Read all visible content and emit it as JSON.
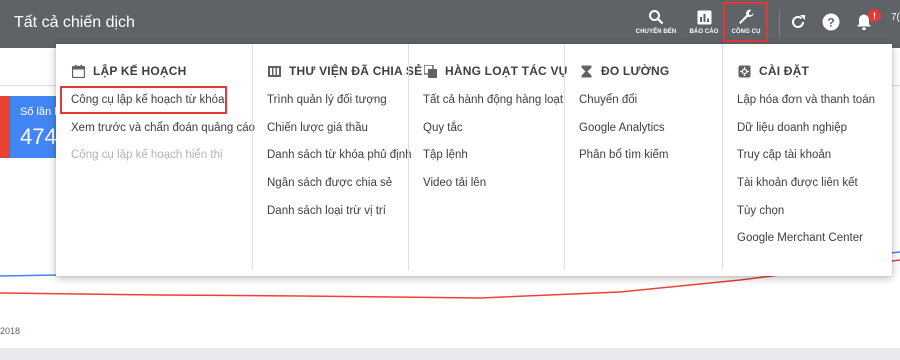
{
  "header": {
    "page_title": "Tất cả chiến dịch",
    "buttons": [
      {
        "label": "CHUYỂN ĐẾN",
        "icon": "search-icon"
      },
      {
        "label": "BÁO CÁO",
        "icon": "bar-chart-icon"
      },
      {
        "label": "CÔNG CỤ",
        "icon": "wrench-icon"
      }
    ],
    "refresh_icon": "refresh-icon",
    "help_icon": "help-icon",
    "notifications_icon": "bell-icon",
    "notification_badge": "!",
    "account_text_partial": "7("
  },
  "background": {
    "right_edge_text": "y",
    "metric": {
      "label": "Số lần hi",
      "value": "474"
    },
    "axis_label": "2018"
  },
  "tools_menu": {
    "columns": [
      {
        "heading": "LẬP KẾ HOẠCH",
        "icon": "calendar-icon",
        "items": [
          {
            "label": "Công cụ lập kế hoạch từ khóa",
            "disabled": false
          },
          {
            "label": "Xem trước và chẩn đoán quảng cáo",
            "disabled": false
          },
          {
            "label": "Công cụ lập kế hoạch hiển thị",
            "disabled": true
          }
        ]
      },
      {
        "heading": "THƯ VIỆN ĐÃ CHIA SẺ",
        "icon": "library-icon",
        "items": [
          {
            "label": "Trình quản lý đối tượng",
            "disabled": false
          },
          {
            "label": "Chiến lược giá thầu",
            "disabled": false
          },
          {
            "label": "Danh sách từ khóa phủ định",
            "disabled": false
          },
          {
            "label": "Ngân sách được chia sẻ",
            "disabled": false
          },
          {
            "label": "Danh sách loại trừ vị trí",
            "disabled": false
          }
        ]
      },
      {
        "heading": "HÀNG LOẠT TÁC VỤ",
        "icon": "bulk-actions-icon",
        "items": [
          {
            "label": "Tất cả hành động hàng loạt",
            "disabled": false
          },
          {
            "label": "Quy tắc",
            "disabled": false
          },
          {
            "label": "Tập lệnh",
            "disabled": false
          },
          {
            "label": "Video tải lên",
            "disabled": false
          }
        ]
      },
      {
        "heading": "ĐO LƯỜNG",
        "icon": "hourglass-icon",
        "items": [
          {
            "label": "Chuyển đổi",
            "disabled": false
          },
          {
            "label": "Google Analytics",
            "disabled": false
          },
          {
            "label": "Phân bổ tìm kiếm",
            "disabled": false
          }
        ]
      },
      {
        "heading": "CÀI ĐẶT",
        "icon": "settings-icon",
        "items": [
          {
            "label": "Lập hóa đơn và thanh toán",
            "disabled": false
          },
          {
            "label": "Dữ liệu doanh nghiệp",
            "disabled": false
          },
          {
            "label": "Truy cập tài khoản",
            "disabled": false
          },
          {
            "label": "Tài khoản được liên kết",
            "disabled": false
          },
          {
            "label": "Tùy chọn",
            "disabled": false
          },
          {
            "label": "Google Merchant Center",
            "disabled": false
          }
        ]
      }
    ]
  },
  "colors": {
    "header_bg": "#5f6368",
    "highlight_red": "#e53935",
    "metric_blue": "#4285f4",
    "metric_red": "#ea4335",
    "disabled_text": "#b0b3b8"
  }
}
